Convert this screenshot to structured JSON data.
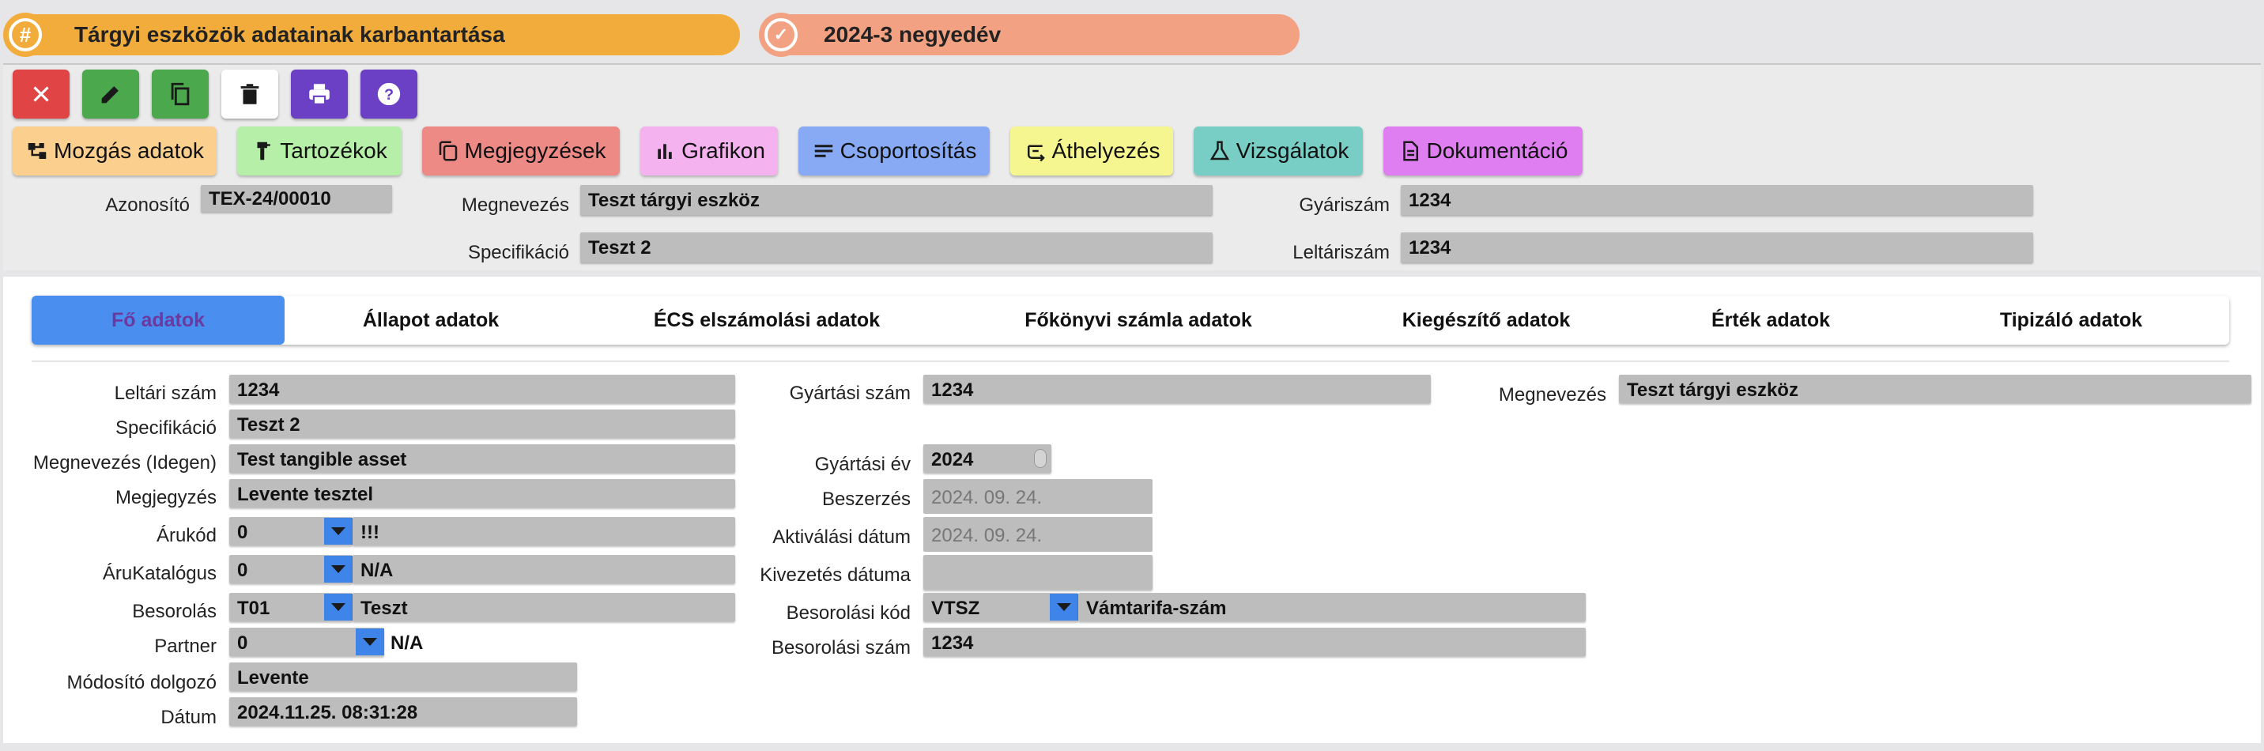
{
  "header": {
    "title": "Tárgyi eszközök adatainak karbantartása",
    "period": "2024-3 negyedév"
  },
  "toolbar": [
    {
      "icon": "close-icon",
      "color": "#e04444"
    },
    {
      "icon": "edit-icon",
      "color": "#4ca84c"
    },
    {
      "icon": "copy-icon",
      "color": "#4ca84c"
    },
    {
      "icon": "trash-icon",
      "color": "#ffffff"
    },
    {
      "icon": "print-icon",
      "color": "#6b40c4"
    },
    {
      "icon": "help-icon",
      "color": "#6b40c4"
    }
  ],
  "nav_buttons": [
    {
      "label": "Mozgás adatok",
      "icon": "movement-icon",
      "color": "#fbd08e"
    },
    {
      "label": "Tartozékok",
      "icon": "accessory-icon",
      "color": "#b6f0a8"
    },
    {
      "label": "Megjegyzések",
      "icon": "notes-icon",
      "color": "#ee8a86"
    },
    {
      "label": "Grafikon",
      "icon": "chart-icon",
      "color": "#f4b2ee"
    },
    {
      "label": "Csoportosítás",
      "icon": "group-icon",
      "color": "#88aaf4"
    },
    {
      "label": "Áthelyezés",
      "icon": "transfer-icon",
      "color": "#f6f690"
    },
    {
      "label": "Vizsgálatok",
      "icon": "flask-icon",
      "color": "#78cec4"
    },
    {
      "label": "Dokumentáció",
      "icon": "document-icon",
      "color": "#de7ef0"
    }
  ],
  "summary": {
    "azonosito_label": "Azonosító",
    "azonosito": "TEX-24/00010",
    "megnevezes_label": "Megnevezés",
    "megnevezes": "Teszt tárgyi eszköz",
    "gyariszam_label": "Gyáriszám",
    "gyariszam": "1234",
    "specifikacio_label": "Specifikáció",
    "specifikacio": "Teszt 2",
    "leltariszam_label": "Leltáriszám",
    "leltariszam": "1234"
  },
  "tabs": [
    "Fő adatok",
    "Állapot adatok",
    "ÉCS elszámolási adatok",
    "Főkönyvi számla adatok",
    "Kiegészítő adatok",
    "Érték adatok",
    "Tipizáló adatok"
  ],
  "form": {
    "leltari_szam_label": "Leltári szám",
    "leltari_szam": "1234",
    "specifikacio_label": "Specifikáció",
    "specifikacio": "Teszt 2",
    "megnevezes_idegen_label": "Megnevezés (Idegen)",
    "megnevezes_idegen": "Test tangible asset",
    "megjegyzes_label": "Megjegyzés",
    "megjegyzes": "Levente tesztel",
    "arukod_label": "Árukód",
    "arukod": "0",
    "arukod_text": "!!!",
    "arukatalogus_label": "ÁruKatalógus",
    "arukatalogus": "0",
    "arukatalogus_text": "N/A",
    "besorolas_label": "Besorolás",
    "besorolas": "T01",
    "besorolas_text": "Teszt",
    "partner_label": "Partner",
    "partner": "0",
    "partner_text": "N/A",
    "modosito_label": "Módosító dolgozó",
    "modosito": "Levente",
    "datum_label": "Dátum",
    "datum": "2024.11.25. 08:31:28",
    "gyartasi_szam_label": "Gyártási szám",
    "gyartasi_szam": "1234",
    "gyartasi_ev_label": "Gyártási év",
    "gyartasi_ev": "2024",
    "beszerzes_label": "Beszerzés",
    "beszerzes": "2024. 09. 24.",
    "aktivalasi_label": "Aktiválási dátum",
    "aktivalasi": "2024. 09. 24.",
    "kivezetes_label": "Kivezetés dátuma",
    "kivezetes": "",
    "besorolasi_kod_label": "Besorolási kód",
    "besorolasi_kod": "VTSZ",
    "besorolasi_kod_text": "Vámtarifa-szám",
    "besorolasi_szam_label": "Besorolási szám",
    "besorolasi_szam": "1234",
    "megnevezes_label": "Megnevezés",
    "megnevezes": "Teszt tárgyi eszköz"
  }
}
